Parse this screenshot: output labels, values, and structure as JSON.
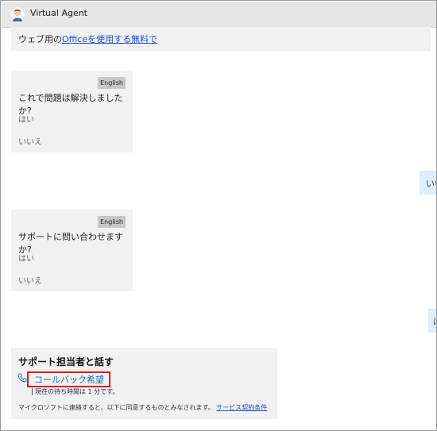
{
  "header": {
    "title": "Virtual Agent",
    "avatar_icon": "agent-avatar-icon"
  },
  "messages": {
    "office_line": {
      "prefix": "ウェブ用の",
      "link": "Officeを使用する無料で"
    },
    "q1": {
      "lang": "English",
      "question": "これで問題は解決しましたか?",
      "yes": "はい",
      "no": "いいえ"
    },
    "user_reply_1": "いい",
    "q2": {
      "lang": "English",
      "question": "サポートに問い合わせますか?",
      "yes": "はい",
      "no": "いいえ"
    },
    "user_reply_2": "は"
  },
  "support": {
    "title": "サポート担当者と話す",
    "callback_label": "コールバック希望",
    "wait_text": "現在の待ち時間は 1 分です。",
    "terms_text": "マイクロソフトに連絡すると、以下に同意するものとみなされます。",
    "terms_link": "サービス契約条件"
  },
  "colors": {
    "accent_red": "#e3141b",
    "link_blue": "#1a4ed6",
    "user_bubble": "#ddeefa",
    "bot_bubble": "#f1f1f1"
  }
}
